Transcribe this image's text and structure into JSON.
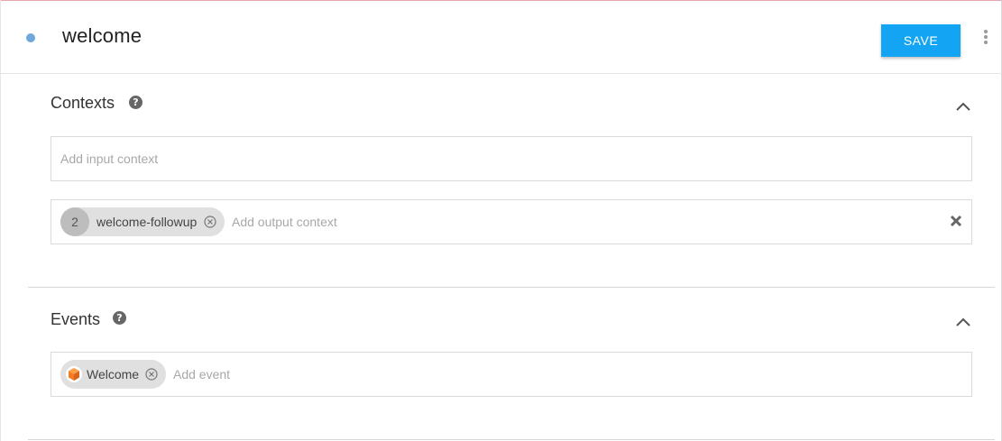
{
  "header": {
    "title": "welcome",
    "save_label": "SAVE"
  },
  "contexts": {
    "title": "Contexts",
    "input_placeholder": "Add input context",
    "output_chip": {
      "count": "2",
      "label": "welcome-followup"
    },
    "output_placeholder": "Add output context"
  },
  "events": {
    "title": "Events",
    "chip": {
      "label": "Welcome"
    },
    "placeholder": "Add event"
  },
  "colors": {
    "accent": "#13a4f4",
    "status_dot": "#6fa8dc",
    "event_icon": "#f47c20"
  },
  "icons": {
    "status": "status-dot-icon",
    "more": "more-vertical-icon",
    "help": "question-circle-icon",
    "collapse": "chevron-up-icon",
    "chip_remove": "close-circle-icon",
    "clear": "close-icon",
    "event": "cube-icon"
  }
}
